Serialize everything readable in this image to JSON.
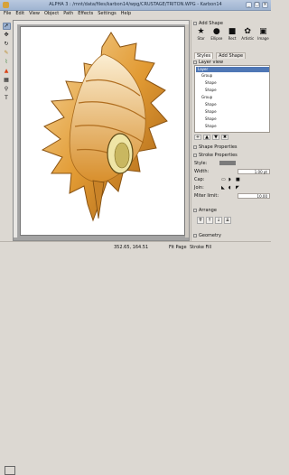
{
  "window": {
    "title": "ALPHA 3 : /mnt/data/files/karbon14/wpg/CRUSTAGE/TRITON.WPG - Karbon14"
  },
  "menu": [
    "File",
    "Edit",
    "View",
    "Object",
    "Path",
    "Effects",
    "Settings",
    "Help"
  ],
  "add_shape": {
    "title": "Add Shape",
    "items": [
      {
        "label": "Star",
        "icon": "star-icon"
      },
      {
        "label": "Ellipse",
        "icon": "ellipse-icon"
      },
      {
        "label": "Rect",
        "icon": "rect-icon"
      },
      {
        "label": "Artistic",
        "icon": "artistic-icon"
      },
      {
        "label": "Image",
        "icon": "image-icon"
      }
    ]
  },
  "tabs": [
    "Styles",
    "Add Shape"
  ],
  "layer_view": {
    "title": "Layer view",
    "rows": [
      {
        "label": "Layer",
        "selected": true
      },
      {
        "label": "Group",
        "selected": false
      },
      {
        "label": "Shape",
        "selected": false
      },
      {
        "label": "Shape",
        "selected": false
      },
      {
        "label": "Group",
        "selected": false
      },
      {
        "label": "Shape",
        "selected": false
      },
      {
        "label": "Shape",
        "selected": false
      },
      {
        "label": "Shape",
        "selected": false
      },
      {
        "label": "Shape",
        "selected": false
      }
    ]
  },
  "shape_properties": {
    "title": "Shape Properties"
  },
  "stroke_properties": {
    "title": "Stroke Properties",
    "style_label": "Style:",
    "width_label": "Width:",
    "width_value": "1.00 pt",
    "cap_label": "Cap:",
    "join_label": "Join:",
    "miter_label": "Miter limit:",
    "miter_value": "10.00"
  },
  "arrange": {
    "title": "Arrange"
  },
  "geometry": {
    "title": "Geometry"
  },
  "status": {
    "coords": "352.65, 164.51",
    "zoom": "Fit Page",
    "extra": "Stroke  Fill"
  },
  "colors": {
    "accent": "#4f77b5",
    "shell_orange": "#e29b34",
    "shell_light": "#f6d9a2"
  }
}
